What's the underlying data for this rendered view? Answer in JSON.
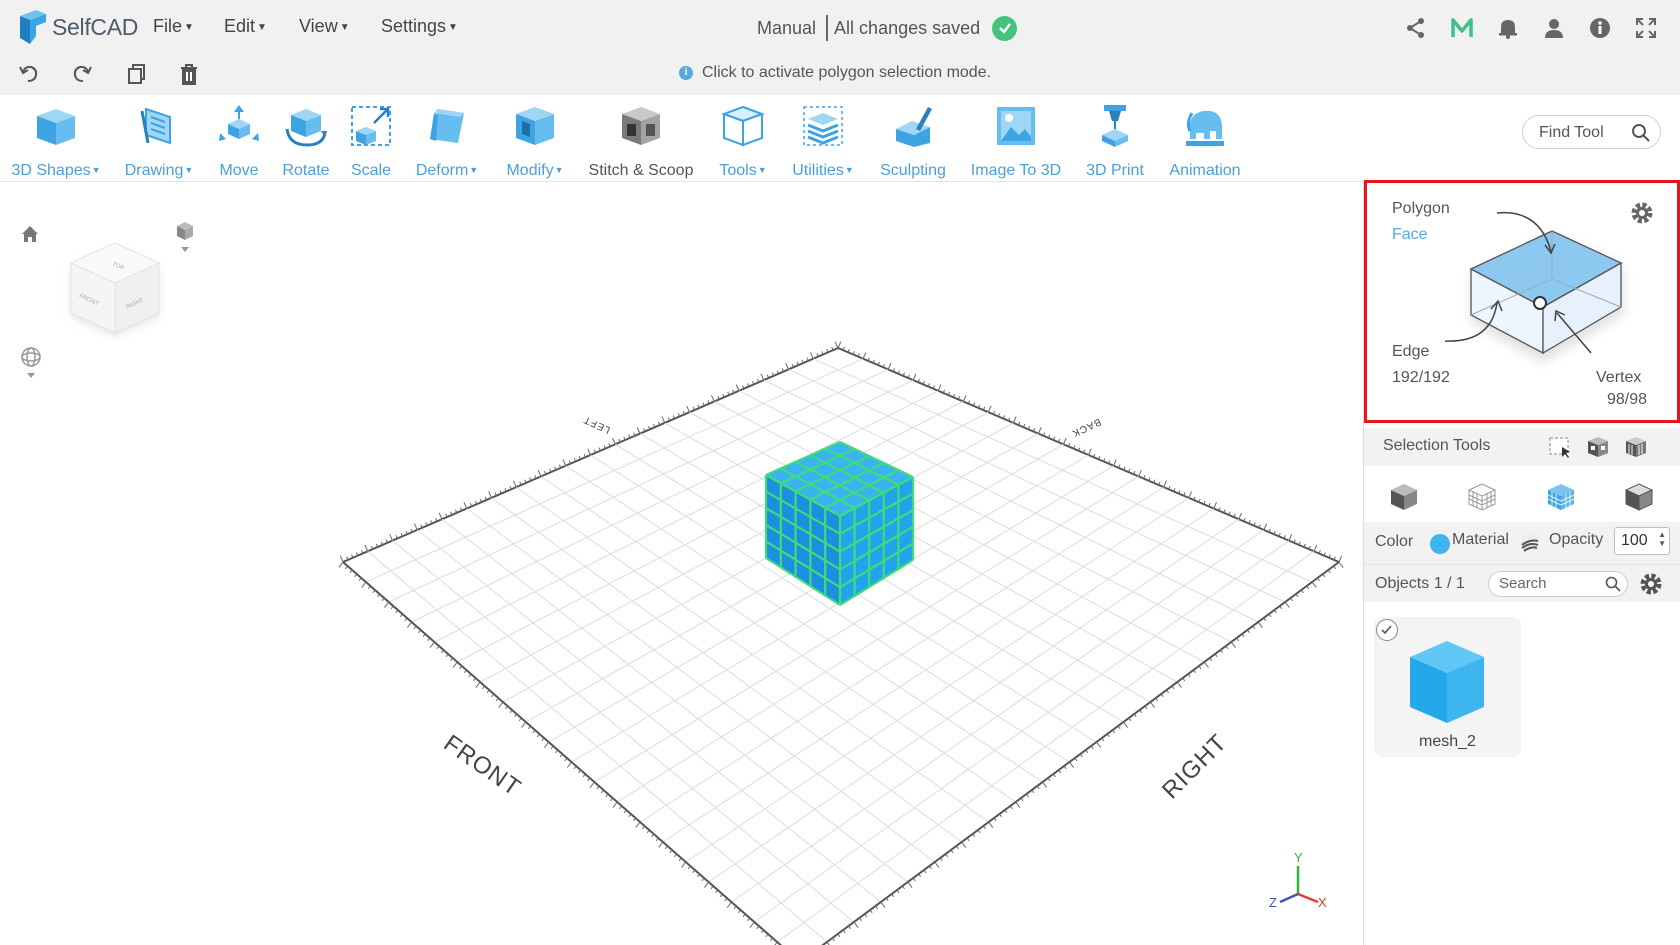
{
  "app": {
    "name": "SelfCAD"
  },
  "menu": {
    "file": "File",
    "edit": "Edit",
    "view": "View",
    "settings": "Settings"
  },
  "status": {
    "mode": "Manual",
    "saved": "All changes saved"
  },
  "hint": {
    "text": "Click to activate polygon selection mode."
  },
  "tools": {
    "shapes": "3D Shapes",
    "drawing": "Drawing",
    "move": "Move",
    "rotate": "Rotate",
    "scale": "Scale",
    "deform": "Deform",
    "modify": "Modify",
    "stitch": "Stitch & Scoop",
    "tools": "Tools",
    "utilities": "Utilities",
    "sculpting": "Sculpting",
    "image3d": "Image To 3D",
    "print": "3D Print",
    "animation": "Animation"
  },
  "find_tool": {
    "placeholder": "Find Tool"
  },
  "viewport": {
    "labels": {
      "front": "FRONT",
      "right": "RIGHT",
      "left": "LEFT",
      "back": "BACK"
    },
    "cube_faces": {
      "top": "TOP",
      "front": "FRONT",
      "right": "RIGHT"
    },
    "axes": {
      "x": "X",
      "y": "Y",
      "z": "Z"
    }
  },
  "selection_panel": {
    "polygon": "Polygon",
    "face": "Face",
    "edge": "Edge",
    "edge_count": "192/192",
    "vertex": "Vertex",
    "vertex_count": "98/98"
  },
  "selection_tools": {
    "label": "Selection Tools"
  },
  "appearance": {
    "color_label": "Color",
    "material_label": "Material",
    "opacity_label": "Opacity",
    "opacity_value": "100",
    "color": "#3db6ef"
  },
  "objects": {
    "label": "Objects 1 / 1",
    "search_placeholder": "Search",
    "items": [
      {
        "name": "mesh_2"
      }
    ]
  },
  "colors": {
    "accent": "#4a9fd9",
    "cube_blue": "#1c9fe6",
    "cube_grid": "#3ddc7a",
    "highlight": "#e3151f",
    "success": "#45c27d"
  }
}
